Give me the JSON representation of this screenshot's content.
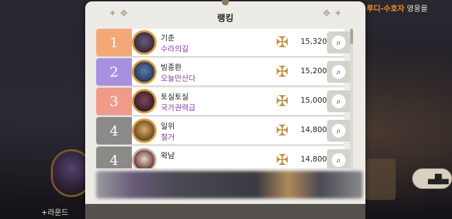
{
  "dialog": {
    "title": "랭킹"
  },
  "background": {
    "notice_highlight": "루디-수호자",
    "notice_text": "영웅을",
    "bottom_left_text": "+라운드"
  },
  "rows": [
    {
      "rank": "1",
      "name": "기춘",
      "guild": "수라의길",
      "score": "15,320",
      "rank_color": "#f4a878"
    },
    {
      "rank": "2",
      "name": "빙종환",
      "guild": "오늘만산다",
      "score": "15,200",
      "rank_color": "#a890e0"
    },
    {
      "rank": "3",
      "name": "토실토실",
      "guild": "국가권력급",
      "score": "15,000",
      "rank_color": "#f09a8a"
    },
    {
      "rank": "4",
      "name": "일위",
      "guild": "철거",
      "score": "14,800",
      "rank_color": "#8c8a88"
    },
    {
      "rank": "4",
      "name": "왁냠",
      "guild": "",
      "score": "14,800",
      "rank_color": "#8c8a88"
    }
  ],
  "icons": {
    "search": "magnifier-icon",
    "tier": "tier-emblem-icon",
    "ranking_button": "podium-icon"
  }
}
